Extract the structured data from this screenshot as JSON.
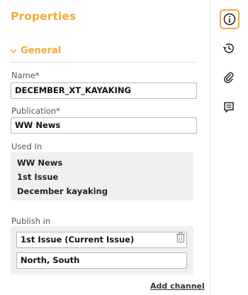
{
  "panel": {
    "title": "Properties",
    "section": "General"
  },
  "fields": {
    "name_label": "Name*",
    "name_value": "DECEMBER_XT_KAYAKING",
    "publication_label": "Publication*",
    "publication_value": "WW News",
    "used_in_label": "Used In",
    "used_in_items": [
      "WW News",
      "1st Issue",
      "December kayaking"
    ],
    "publish_in_label": "Publish in",
    "publish_issue": "1st Issue (Current Issue)",
    "publish_editions": "North,  South",
    "add_channel": "Add channel"
  },
  "sidebar": {
    "icons": [
      "info-icon",
      "history-icon",
      "attachment-icon",
      "comments-icon"
    ],
    "active": "info-icon"
  },
  "colors": {
    "accent": "#f2a93b",
    "box_bg": "#f0f0f0"
  }
}
